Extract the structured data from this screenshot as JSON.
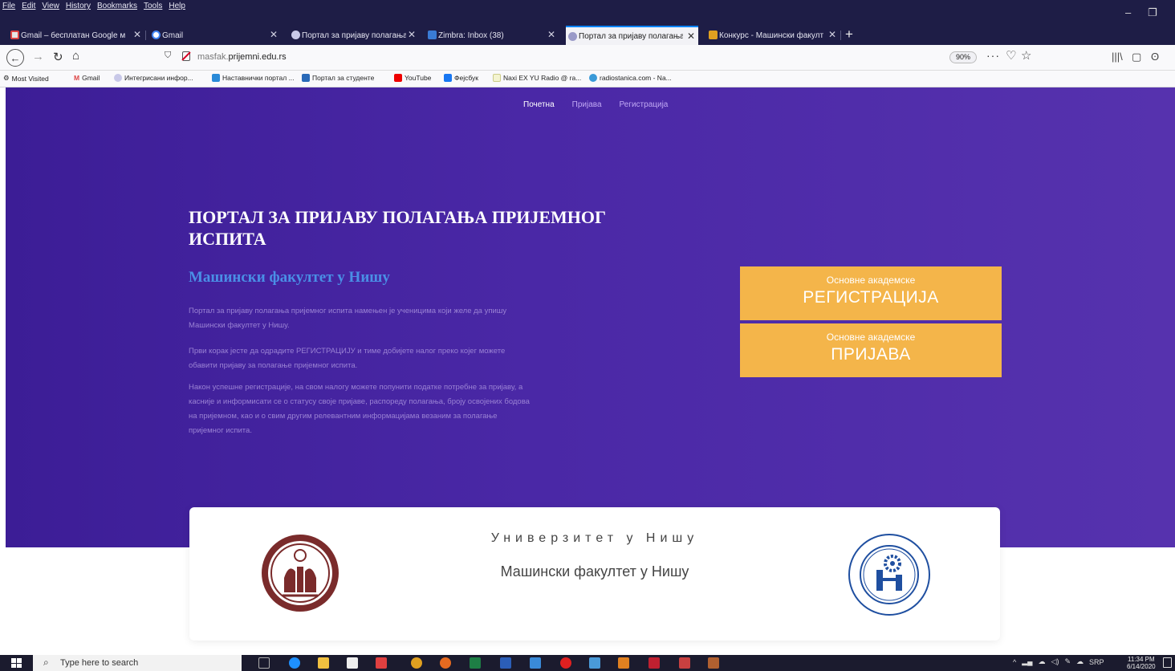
{
  "menubar": {
    "items": [
      "File",
      "Edit",
      "View",
      "History",
      "Bookmarks",
      "Tools",
      "Help"
    ]
  },
  "tabs": [
    {
      "label": "Gmail – бесплатан Google мес",
      "active": false
    },
    {
      "label": "Gmail",
      "active": false
    },
    {
      "label": "Портал за пријаву полагања п",
      "active": false
    },
    {
      "label": "Zimbra: Inbox (38)",
      "active": false
    },
    {
      "label": "Портал за пријаву полагања п",
      "active": true
    },
    {
      "label": "Конкурс - Машински факулт",
      "active": false
    }
  ],
  "navbar": {
    "url_dim": "masfak.",
    "url_main": "prijemni.edu.rs",
    "zoom": "90%"
  },
  "bookmarks": [
    "Most Visited",
    "Gmail",
    "Интегрисани инфор...",
    "Наставнички портал ...",
    "Портал за студенте",
    "YouTube",
    "Фејсбук",
    "Naxi EX YU Radio @ ra...",
    "radiostanica.com - Na..."
  ],
  "site": {
    "nav": {
      "home": "Почетна",
      "login": "Пријава",
      "register": "Регистрација"
    },
    "hero": {
      "title": "ПОРТАЛ ЗА ПРИЈАВУ ПОЛАГАЊА ПРИЈЕМНОГ ИСПИТА",
      "subtitle": "Машински факултет у Нишу",
      "para1": "Портал за пријаву полагања пријемног испита намењен је ученицима који желе да упишу Машински факултет у Нишу.",
      "para2": "Први корак јесте да одрадите РЕГИСТРАЦИЈУ и тиме добијете налог преко којег можете обавити пријаву за полагање пријемног испита.",
      "para3": "Након успешне регистрације, на свом налогу можете попунити податке потребне за пријаву, а касније и информисати се о статусу своје пријаве, распореду полагања, броју освојених бодова на пријемном, као и о свим другим релевантним информацијама везаним за полагање пријемног испита."
    },
    "cta_register": {
      "small": "Основне академске",
      "big": "РЕГИСТРАЦИЈА"
    },
    "cta_apply": {
      "small": "Основне академске",
      "big": "ПРИЈАВА"
    },
    "card": {
      "university": "Универзитет у Нишу",
      "faculty": "Машински факултет у Нишу"
    }
  },
  "taskbar": {
    "search_placeholder": "Type here to search",
    "lang": "SRP",
    "time": "11:34 PM",
    "date": "6/14/2020"
  },
  "colors": {
    "hero_left": "#3c1d96",
    "hero_right": "#5632ae",
    "cta": "#f4b54a",
    "subtitle": "#4a8fe6",
    "logo_uni": "#7a2b2b",
    "logo_fac": "#1f4fa0"
  }
}
